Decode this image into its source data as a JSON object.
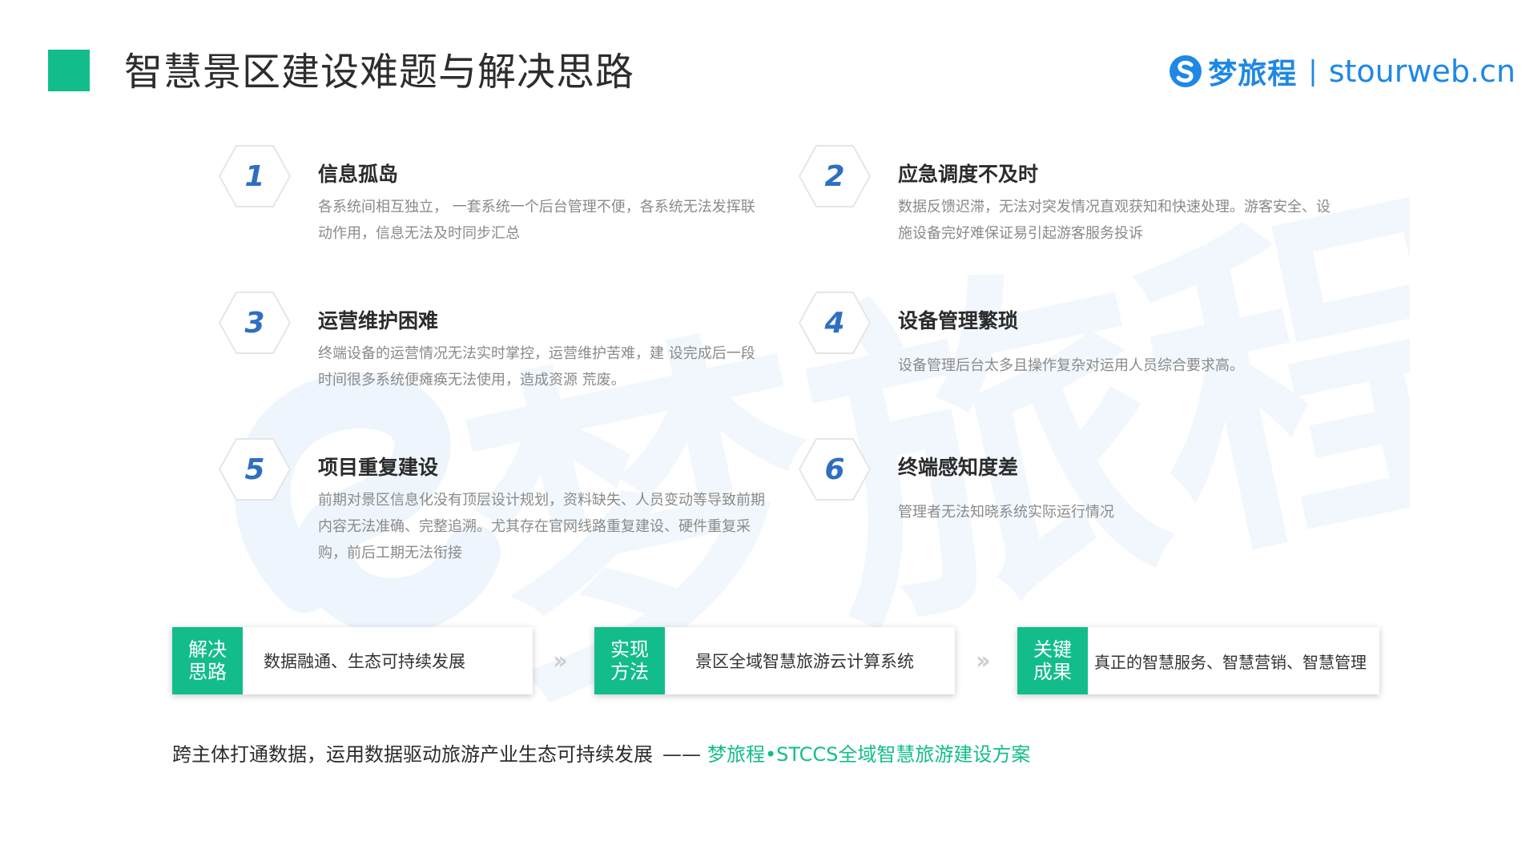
{
  "header": {
    "title": "智慧景区建设难题与解决思路",
    "brand_name": "梦旅程",
    "brand_sep": "|",
    "brand_url": "stourweb.cn"
  },
  "watermark_text": "梦旅程",
  "items": [
    {
      "num": "1",
      "title": "信息孤岛",
      "desc": "各系统间相互独立， 一套系统一个后台管理不便，各系统无法发挥联动作用，信息无法及时同步汇总"
    },
    {
      "num": "2",
      "title": "应急调度不及时",
      "desc": "数据反馈迟滞，无法对突发情况直观获知和快速处理。游客安全、设施设备完好难保证易引起游客服务投诉"
    },
    {
      "num": "3",
      "title": "运营维护困难",
      "desc": "终端设备的运营情况无法实时掌控，运营维护苦难，建 设完成后一段时间很多系统便瘫痪无法使用，造成资源 荒废。"
    },
    {
      "num": "4",
      "title": "设备管理繁琐",
      "desc": "设备管理后台太多且操作复杂对运用人员综合要求高。"
    },
    {
      "num": "5",
      "title": "项目重复建设",
      "desc": "前期对景区信息化没有顶层设计规划，资料缺失、人员变动等导致前期内容无法准确、完整追溯。尤其存在官网线路重复建设、硬件重复采购，前后工期无法衔接"
    },
    {
      "num": "6",
      "title": "终端感知度差",
      "desc": "管理者无法知晓系统实际运行情况"
    }
  ],
  "solutions": [
    {
      "tag": "解决思路",
      "text": "数据融通、生态可持续发展"
    },
    {
      "tag": "实现方法",
      "text": "景区全域智慧旅游云计算系统"
    },
    {
      "tag": "关键成果",
      "text": "真正的智慧服务、智慧营销、智慧管理"
    }
  ],
  "arrow_glyph": "››",
  "footer": {
    "text": "跨主体打通数据，运用数据驱动旅游产业生态可持续发展",
    "dash": "——",
    "accent": "梦旅程•STCCS全域智慧旅游建设方案"
  },
  "colors": {
    "accent_green": "#12bd8b",
    "brand_blue": "#1e88e5",
    "number_blue": "#2f6fc0"
  }
}
